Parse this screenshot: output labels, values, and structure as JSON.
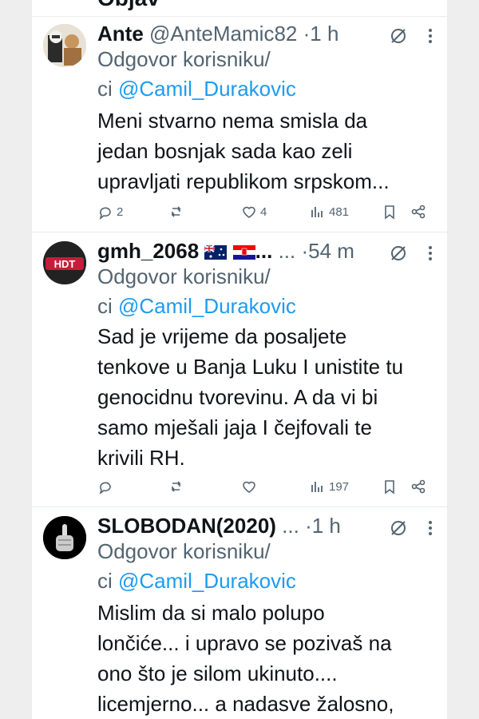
{
  "top_cut_text": "Objav",
  "tweets": [
    {
      "name": "Ante",
      "handle": "@AnteMamic82",
      "dot": "·",
      "time": "1 h",
      "reply_prefix_1": "Odgovor korisniku/",
      "reply_prefix_2": "ci ",
      "mention": "@Camil_Durakovic",
      "text_lines": [
        "Meni stvarno nema smisla da",
        "jedan bosnjak sada kao zeli",
        "upravljati republikom srpskom..."
      ],
      "replies": "2",
      "retweets": "",
      "likes": "4",
      "views": "481"
    },
    {
      "name": "gmh_2068",
      "name_suffix": "...",
      "handle": "...",
      "dot": "·",
      "time": "54 m",
      "reply_prefix_1": "Odgovor korisniku/",
      "reply_prefix_2": "ci ",
      "mention": "@Camil_Durakovic",
      "text_lines": [
        "Sad je vrijeme da posaljete",
        "tenkove u Banja Luku I unistite tu",
        "genocidnu tvorevinu. A da vi bi",
        "samo mješali jaja I čejfovali te",
        "krivili RH."
      ],
      "replies": "",
      "retweets": "",
      "likes": "",
      "views": "197"
    },
    {
      "name": "SLOBODAN(2020)",
      "handle": "...",
      "dot": "·",
      "time": "1 h",
      "reply_prefix_1": "Odgovor korisniku/",
      "reply_prefix_2": "ci ",
      "mention": "@Camil_Durakovic",
      "text_lines": [
        "Mislim da si malo polupo",
        "lončiće... i upravo se pozivaš na",
        "ono što je silom ukinuto....",
        "licemjerno... a nadasve žalosno,"
      ]
    }
  ],
  "avatar_badge_text": "HDT",
  "colors": {
    "accent": "#1d9bf0",
    "secondary_text": "#536471",
    "divider": "#e6ecf0"
  }
}
